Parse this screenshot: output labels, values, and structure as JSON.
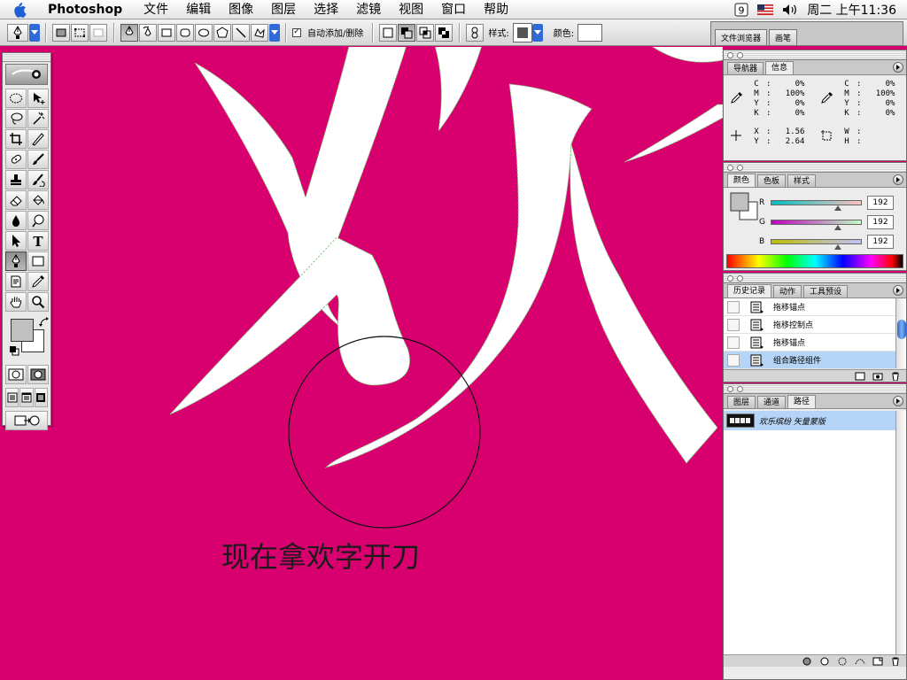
{
  "menubar": {
    "apple_icon": "apple-icon",
    "items": [
      "Photoshop",
      "文件",
      "编辑",
      "图像",
      "图层",
      "选择",
      "滤镜",
      "视图",
      "窗口",
      "帮助"
    ],
    "clock": "周二 上午11:36",
    "status_icons": [
      "script-icon",
      "us-flag-icon",
      "volume-icon"
    ]
  },
  "options_bar": {
    "auto_add_delete_label": "自动添加/删除",
    "auto_add_checked": true,
    "style_label": "样式:",
    "color_label": "颜色:",
    "color_value": "#ffffff"
  },
  "palette_well": {
    "tabs": [
      "文件浏览器",
      "画笔"
    ]
  },
  "canvas": {
    "background": "#d8006f",
    "caption": "现在拿欢字开刀"
  },
  "toolbox": {
    "fg_color": "#c0c0c0",
    "bg_color": "#ffffff",
    "tools": [
      "marquee-icon",
      "move-icon",
      "lasso-icon",
      "magic-wand-icon",
      "crop-icon",
      "slice-icon",
      "healing-brush-icon",
      "brush-icon",
      "clone-stamp-icon",
      "history-brush-icon",
      "eraser-icon",
      "paint-bucket-icon",
      "blur-icon",
      "dodge-icon",
      "path-selection-icon",
      "type-icon",
      "pen-icon",
      "rectangle-icon",
      "notes-icon",
      "eyedropper-icon",
      "hand-icon",
      "zoom-icon"
    ]
  },
  "info_palette": {
    "tabs": [
      "导航器",
      "信息"
    ],
    "active_tab": "信息",
    "left_cmyk": [
      [
        "C",
        "0%"
      ],
      [
        "M",
        "100%"
      ],
      [
        "Y",
        "0%"
      ],
      [
        "K",
        "0%"
      ]
    ],
    "right_cmyk": [
      [
        "C",
        "0%"
      ],
      [
        "M",
        "100%"
      ],
      [
        "Y",
        "0%"
      ],
      [
        "K",
        "0%"
      ]
    ],
    "x_label": "X",
    "x_value": "1.56",
    "y_label": "Y",
    "y_value": "2.64",
    "w_label": "W",
    "w_value": "",
    "h_label": "H",
    "h_value": ""
  },
  "color_palette": {
    "tabs": [
      "颜色",
      "色板",
      "样式"
    ],
    "active_tab": "颜色",
    "channels": [
      {
        "name": "R",
        "value": "192"
      },
      {
        "name": "G",
        "value": "192"
      },
      {
        "name": "B",
        "value": "192"
      }
    ]
  },
  "history_palette": {
    "tabs": [
      "历史记录",
      "动作",
      "工具预设"
    ],
    "active_tab": "历史记录",
    "items": [
      "拖移锚点",
      "拖移控制点",
      "拖移锚点",
      "组合路径组件"
    ],
    "selected_index": 3
  },
  "paths_palette": {
    "tabs": [
      "图层",
      "通道",
      "路径"
    ],
    "active_tab": "路径",
    "items": [
      "欢乐缤纷 矢量蒙版"
    ]
  }
}
